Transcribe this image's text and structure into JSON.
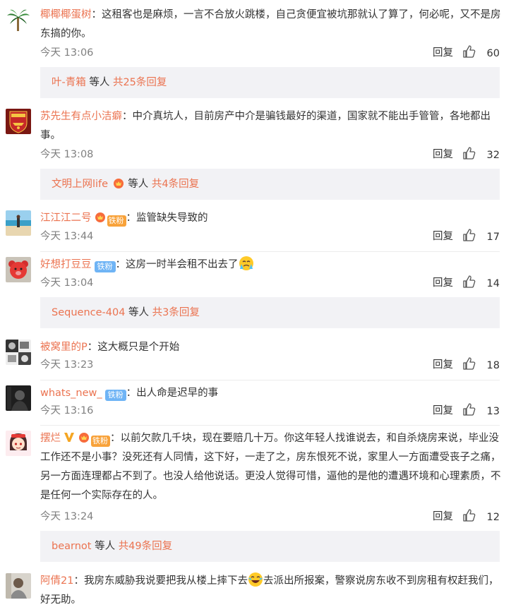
{
  "comments": [
    {
      "user": "椰椰椰蛋树",
      "text": "：这租客也是麻烦，一言不合放火跳楼，自己贪便宜被坑那就认了算了，何必呢，又不是房东搞的你。",
      "time": "今天 13:06",
      "reply": "回复",
      "likes": "60",
      "replies_user": "叶-青箱",
      "replies_mid": " 等人 ",
      "replies_count": "共25条回复"
    },
    {
      "user": "苏先生有点小洁癖",
      "text": "：中介真坑人，目前房产中介是骗钱最好的渠道，国家就不能出手管管，各地都出事。",
      "time": "今天 13:08",
      "reply": "回复",
      "likes": "32",
      "replies_user": "文明上网life",
      "replies_mid": " 等人 ",
      "replies_count": "共4条回复"
    },
    {
      "user": "江江江二号",
      "badge": "铁粉",
      "text": "：监管缺失导致的",
      "time": "今天 13:44",
      "reply": "回复",
      "likes": "17"
    },
    {
      "user": "好想打豆豆",
      "badge": "铁粉",
      "text": "：这房一时半会租不出去了",
      "time": "今天 13:04",
      "reply": "回复",
      "likes": "14",
      "replies_user": "Sequence-404",
      "replies_mid": " 等人 ",
      "replies_count": "共3条回复"
    },
    {
      "user": "被窝里的P",
      "text": "：这大概只是个开始",
      "time": "今天 13:23",
      "reply": "回复",
      "likes": "18"
    },
    {
      "user": "whats_new_",
      "badge": "铁粉",
      "text": "：出人命是迟早的事",
      "time": "今天 13:16",
      "reply": "回复",
      "likes": "13"
    },
    {
      "user": "摆烂",
      "badge": "铁粉",
      "text": "：以前欠款几千块，现在要赔几十万。你这年轻人找谁说去，和自杀烧房来说，毕业没工作还不是小事？没死还有人同情，这下好，一走了之，房东恨死不说，家里人一方面遭受丧子之痛，另一方面连理都占不到了。也没人给他说话。更没人觉得可惜，逼他的是他的遭遇环境和心理素质，不是任何一个实际存在的人。",
      "time": "今天 13:24",
      "reply": "回复",
      "likes": "12",
      "replies_user": "bearnot",
      "replies_mid": " 等人 ",
      "replies_count": "共49条回复"
    },
    {
      "user": "阿倩21",
      "text_a": "：我房东威胁我说要把我从楼上摔下去",
      "text_b": "去派出所报案，警察说房东收不到房租有权赶我们，好无助。"
    }
  ]
}
